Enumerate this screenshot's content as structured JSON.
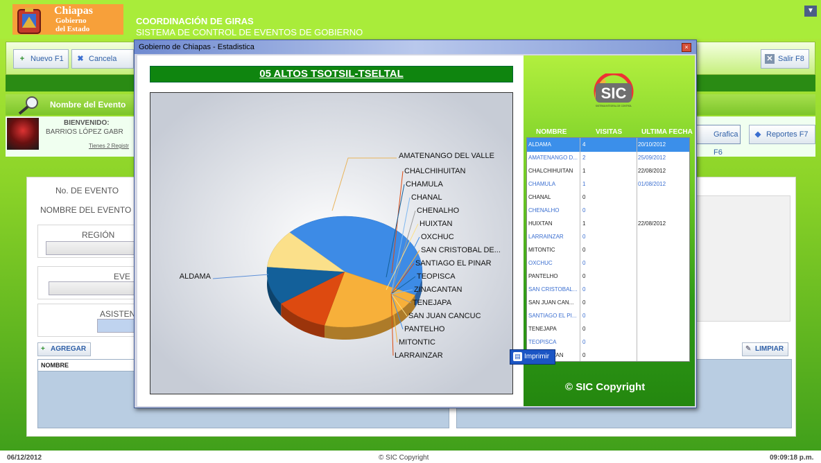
{
  "header": {
    "logo_line1": "Chiapas",
    "logo_line2": "Gobierno",
    "logo_line3": "del Estado",
    "title": "COORDINACIÓN DE GIRAS",
    "subtitle": "SISTEMA DE CONTROL DE EVENTOS DE GOBIERNO"
  },
  "toolbar": {
    "nuevo": "Nuevo F1",
    "cancelar": "Cancela",
    "salir": "Salir F8",
    "grafica": "Grafica F6",
    "reportes": "Reportes F7"
  },
  "search": {
    "label": "Nombre del Evento"
  },
  "user": {
    "welcome": "BIENVENIDO:",
    "name": "BARRIOS LÓPEZ GABR",
    "records": "Tienes 2 Registr"
  },
  "form": {
    "no_evento": "No. DE EVENTO",
    "nombre_evento": "NOMBRE DEL EVENTO",
    "region": "REGIÓN",
    "evento": "EVE",
    "asistentes": "ASISTEN",
    "agregar": "AGREGAR",
    "limpiar": "LIMPIAR",
    "col_nombre": "NOMBRE"
  },
  "status": {
    "date": "06/12/2012",
    "copyright": "© SIC Copyright",
    "time": "09:09:18 p.m."
  },
  "dialog": {
    "title": "Gobierno de Chiapas - Estadistica",
    "close": "×",
    "print": "Imprimir",
    "copyright": "© SIC Copyright",
    "logo": "SIC",
    "logo_sub": "SISTEMA INTEGRAL DE CONTROL",
    "table": {
      "headers": [
        "NOMBRE",
        "VISITAS",
        "ULTIMA FECHA"
      ],
      "rows": [
        {
          "name": "ALDAMA",
          "visits": "4",
          "date": "20/10/2012"
        },
        {
          "name": "AMATENANGO D...",
          "visits": "2",
          "date": "25/09/2012"
        },
        {
          "name": "CHALCHIHUITAN",
          "visits": "1",
          "date": "22/08/2012"
        },
        {
          "name": "CHAMULA",
          "visits": "1",
          "date": "01/08/2012"
        },
        {
          "name": "CHANAL",
          "visits": "0",
          "date": ""
        },
        {
          "name": "CHENALHO",
          "visits": "0",
          "date": ""
        },
        {
          "name": "HUIXTAN",
          "visits": "1",
          "date": "22/08/2012"
        },
        {
          "name": "LARRAINZAR",
          "visits": "0",
          "date": ""
        },
        {
          "name": "MITONTIC",
          "visits": "0",
          "date": ""
        },
        {
          "name": "OXCHUC",
          "visits": "0",
          "date": ""
        },
        {
          "name": "PANTELHO",
          "visits": "0",
          "date": ""
        },
        {
          "name": "SAN CRISTOBAL...",
          "visits": "0",
          "date": ""
        },
        {
          "name": "SAN JUAN CAN...",
          "visits": "0",
          "date": ""
        },
        {
          "name": "SANTIAGO EL PI...",
          "visits": "0",
          "date": ""
        },
        {
          "name": "TENEJAPA",
          "visits": "0",
          "date": ""
        },
        {
          "name": "TEOPISCA",
          "visits": "0",
          "date": ""
        },
        {
          "name": "ZINACANTAN",
          "visits": "0",
          "date": ""
        }
      ]
    }
  },
  "chart_data": {
    "type": "pie",
    "title": "05 ALTOS TSOTSIL-TSELTAL",
    "slices": [
      {
        "label": "ALDAMA",
        "value": 4,
        "color": "#3d8be6"
      },
      {
        "label": "AMATENANGO DEL VALLE",
        "value": 2,
        "color": "#f7b03a"
      },
      {
        "label": "CHALCHIHUITAN",
        "value": 1,
        "color": "#dd4a10"
      },
      {
        "label": "CHAMULA",
        "value": 1,
        "color": "#13609a"
      },
      {
        "label": "CHENALHO",
        "value": 0,
        "color": "#7fb8f0"
      },
      {
        "label": "CHANAL",
        "value": 0,
        "color": "#9b9b9b"
      },
      {
        "label": "HUIXTAN",
        "value": 1,
        "color": "#fbe08a"
      },
      {
        "label": "OXCHUC",
        "value": 0,
        "color": "#3d8be6"
      },
      {
        "label": "SAN CRISTOBAL  DE...",
        "value": 0,
        "color": "#f7b03a"
      },
      {
        "label": "SANTIAGO EL PINAR",
        "value": 0,
        "color": "#dd4a10"
      },
      {
        "label": "TEOPISCA",
        "value": 0,
        "color": "#13609a"
      },
      {
        "label": "ZINACANTAN",
        "value": 0,
        "color": "#7fb8f0"
      },
      {
        "label": "TENEJAPA",
        "value": 0,
        "color": "#9b9b9b"
      },
      {
        "label": "SAN JUAN CANCUC",
        "value": 0,
        "color": "#fbe08a"
      },
      {
        "label": "PANTELHO",
        "value": 0,
        "color": "#3d8be6"
      },
      {
        "label": "MITONTIC",
        "value": 0,
        "color": "#f7b03a"
      },
      {
        "label": "LARRAINZAR",
        "value": 0,
        "color": "#13609a"
      }
    ]
  }
}
